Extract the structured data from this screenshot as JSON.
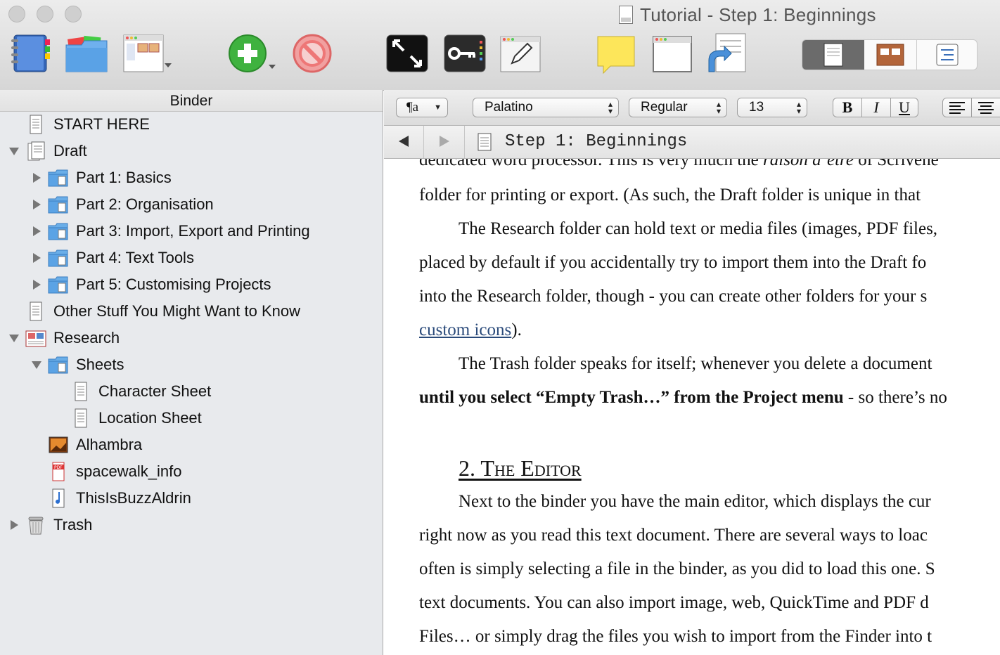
{
  "window": {
    "title": "Tutorial - Step 1: Beginnings"
  },
  "toolbar": {
    "icons": [
      "binder-icon",
      "collections-icon",
      "layout-icon",
      "add-icon",
      "delete-icon",
      "fullscreen-icon",
      "keywords-icon",
      "inspector-edit-icon",
      "note-icon",
      "quick-reference-icon",
      "compile-icon",
      "view-document-icon",
      "view-corkboard-icon",
      "view-outline-icon"
    ]
  },
  "binder": {
    "title": "Binder",
    "items": [
      {
        "label": "START HERE",
        "icon": "text-document-icon"
      },
      {
        "label": "Draft",
        "icon": "draft-folder-icon"
      },
      {
        "label": "Part 1: Basics",
        "icon": "folder-icon"
      },
      {
        "label": "Part 2: Organisation",
        "icon": "folder-icon"
      },
      {
        "label": "Part 3: Import, Export and Printing",
        "icon": "folder-icon"
      },
      {
        "label": "Part 4: Text Tools",
        "icon": "folder-icon"
      },
      {
        "label": "Part 5: Customising Projects",
        "icon": "folder-icon"
      },
      {
        "label": "Other Stuff You Might Want to Know",
        "icon": "text-document-icon"
      },
      {
        "label": "Research",
        "icon": "research-folder-icon"
      },
      {
        "label": "Sheets",
        "icon": "folder-icon"
      },
      {
        "label": "Character Sheet",
        "icon": "text-document-icon"
      },
      {
        "label": "Location Sheet",
        "icon": "text-document-icon"
      },
      {
        "label": "Alhambra",
        "icon": "image-icon"
      },
      {
        "label": "spacewalk_info",
        "icon": "pdf-icon"
      },
      {
        "label": "ThisIsBuzzAldrin",
        "icon": "audio-icon"
      },
      {
        "label": "Trash",
        "icon": "trash-icon"
      }
    ]
  },
  "formatbar": {
    "paragraph_style": "¶a",
    "font": "Palatino",
    "style": "Regular",
    "size": "13",
    "bold": "B",
    "italic": "I",
    "underline": "U"
  },
  "editor": {
    "header_title": "Step 1: Beginnings",
    "lines": [
      {
        "t": "dedicated word processor. This is very much the "
      },
      {
        "t": "folder for printing or export. (As such, the Draft folder is unique in that"
      },
      {
        "t": "The Research folder can hold text or media files (images, PDF files,"
      },
      {
        "t": "placed by default if you accidentally try to import them into the Draft fo"
      },
      {
        "t": "into the Research folder, though - you can create other folders for your s"
      },
      {
        "t": "The Trash folder speaks for itself; whenever you delete a document"
      },
      {
        "t": " - so there’s no"
      }
    ],
    "raison": "raison d’être",
    "of_scrivener": " of Scrivene",
    "link_text": "custom icons",
    "after_link": ").",
    "bold_text": "until you select “Empty Trash…” from the Project menu",
    "heading": "2. The Editor",
    "lines2": [
      "Next to the binder you have the main editor, which displays the cur",
      "right now as you read this text document. There are several ways to loac",
      "often is simply selecting a file in the binder, as you did to load this one. S",
      "text documents. You can also import image, web, QuickTime and PDF d",
      "Files… or simply drag the files you wish to import from the Finder into t"
    ]
  }
}
